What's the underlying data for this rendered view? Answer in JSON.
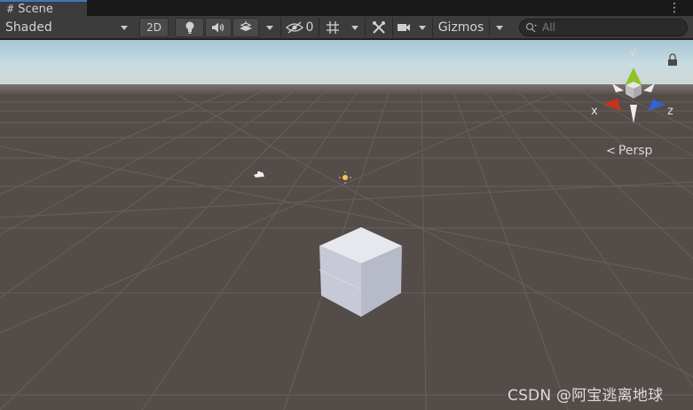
{
  "tab": {
    "icon": "grid-hash-icon",
    "title": "Scene"
  },
  "toolbar": {
    "shading_mode": "Shaded",
    "mode_2d": "2D",
    "hidden_count": "0",
    "gizmos_label": "Gizmos",
    "search_placeholder": "All"
  },
  "viewport": {
    "projection_label": "Persp",
    "gizmo_axes": {
      "x": "x",
      "y": "y",
      "z": "z"
    },
    "colors": {
      "x_axis": "#c8331e",
      "y_axis": "#8fc323",
      "z_axis": "#2f64d6",
      "sky": "#a6c6d4",
      "ground": "#544c49"
    }
  },
  "watermark": "CSDN @阿宝逃离地球"
}
